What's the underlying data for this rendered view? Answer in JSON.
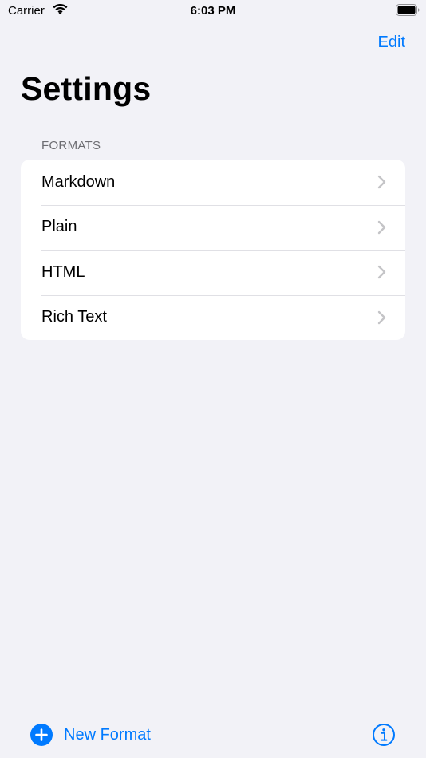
{
  "status_bar": {
    "carrier": "Carrier",
    "time": "6:03 PM"
  },
  "nav": {
    "edit_label": "Edit",
    "title": "Settings"
  },
  "formats": {
    "header": "FORMATS",
    "items": [
      {
        "label": "Markdown"
      },
      {
        "label": "Plain"
      },
      {
        "label": "HTML"
      },
      {
        "label": "Rich Text"
      }
    ]
  },
  "toolbar": {
    "new_format_label": "New Format"
  },
  "colors": {
    "accent": "#007aff",
    "background": "#f2f2f7",
    "card": "#ffffff",
    "secondary_text": "#6d6d72",
    "chevron": "#c4c4c7"
  },
  "icons": {
    "wifi": "wifi-icon",
    "battery": "battery-icon",
    "chevron": "chevron-right-icon",
    "plus": "plus-circle-icon",
    "info": "info-icon"
  }
}
